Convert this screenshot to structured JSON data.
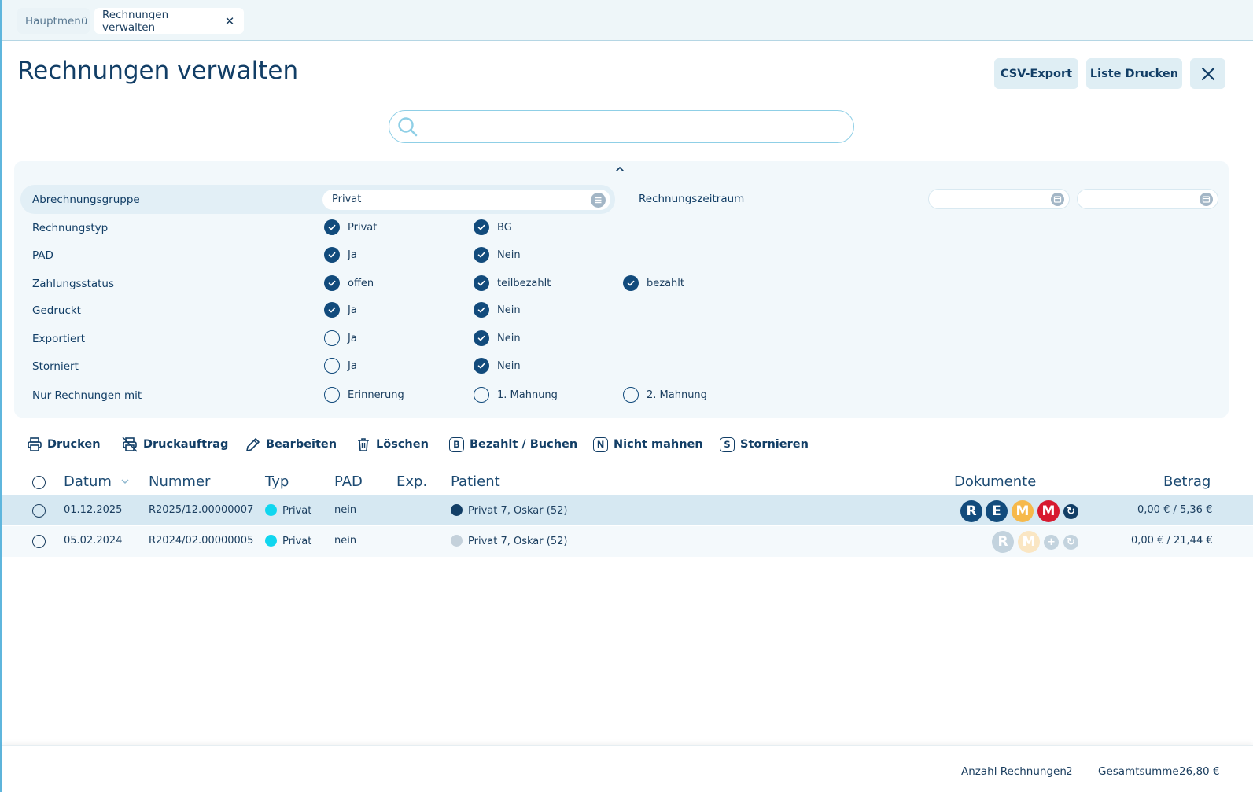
{
  "tabs": [
    {
      "label": "Hauptmenü",
      "active": false
    },
    {
      "label": "Rechnungen verwalten",
      "active": true,
      "close": "✕"
    }
  ],
  "header": {
    "title": "Rechnungen verwalten",
    "csv_label": "CSV-Export",
    "print_list_label": "Liste Drucken",
    "close_glyph": "✕"
  },
  "search": {
    "value": "",
    "placeholder": ""
  },
  "filters": {
    "group_label": "Abrechnungsgruppe",
    "group_value": "Privat",
    "period_label": "Rechnungszeitraum",
    "period_from": "",
    "period_to": "",
    "rows": [
      {
        "label": "Rechnungstyp",
        "options": [
          {
            "label": "Privat",
            "checked": true
          },
          {
            "label": "BG",
            "checked": true
          }
        ]
      },
      {
        "label": "PAD",
        "options": [
          {
            "label": "Ja",
            "checked": true
          },
          {
            "label": "Nein",
            "checked": true
          }
        ]
      },
      {
        "label": "Zahlungsstatus",
        "options": [
          {
            "label": "offen",
            "checked": true
          },
          {
            "label": "teilbezahlt",
            "checked": true
          },
          {
            "label": "bezahlt",
            "checked": true
          }
        ]
      },
      {
        "label": "Gedruckt",
        "options": [
          {
            "label": "Ja",
            "checked": true
          },
          {
            "label": "Nein",
            "checked": true
          }
        ]
      },
      {
        "label": "Exportiert",
        "options": [
          {
            "label": "Ja",
            "checked": false
          },
          {
            "label": "Nein",
            "checked": true
          }
        ]
      },
      {
        "label": "Storniert",
        "options": [
          {
            "label": "Ja",
            "checked": false
          },
          {
            "label": "Nein",
            "checked": true
          }
        ]
      },
      {
        "label": "Nur Rechnungen mit",
        "options": [
          {
            "label": "Erinnerung",
            "checked": false
          },
          {
            "label": "1. Mahnung",
            "checked": false
          },
          {
            "label": "2. Mahnung",
            "checked": false
          }
        ]
      }
    ]
  },
  "actions": {
    "print": "Drucken",
    "print_job": "Druckauftrag",
    "edit": "Bearbeiten",
    "delete": "Löschen",
    "paid": {
      "letter": "B",
      "label": "Bezahlt / Buchen"
    },
    "no_dunning": {
      "letter": "N",
      "label": "Nicht mahnen"
    },
    "cancel": {
      "letter": "S",
      "label": "Stornieren"
    }
  },
  "table": {
    "columns": {
      "date": "Datum",
      "number": "Nummer",
      "type": "Typ",
      "pad": "PAD",
      "exp": "Exp.",
      "patient": "Patient",
      "documents": "Dokumente",
      "amount": "Betrag"
    },
    "rows": [
      {
        "date": "01.12.2025",
        "number": "R2025/12.00000007",
        "type": "Privat",
        "pad": "nein",
        "patient": "Privat 7, Oskar (52)",
        "amount": "0,00 € / 5,36 €",
        "docs": [
          "R",
          "E",
          "M",
          "M"
        ]
      },
      {
        "date": "05.02.2024",
        "number": "R2024/02.00000005",
        "type": "Privat",
        "pad": "nein",
        "patient": "Privat 7, Oskar (52)",
        "amount": "0,00 € / 21,44 €",
        "docs": [
          "R",
          "M"
        ]
      }
    ]
  },
  "footer": {
    "count_label": "Anzahl Rechnungen",
    "count_value": "2",
    "total_label": "Gesamtsumme",
    "total_value": "26,80 €"
  },
  "colors": {
    "primary": "#123e66",
    "doc_r": "#124b7c",
    "doc_e": "#124b7c",
    "doc_m_orange": "#f6b94b",
    "doc_m_red": "#d7192f",
    "type_dot": "#10d6ef",
    "row_selected": "#d6e8f2"
  }
}
